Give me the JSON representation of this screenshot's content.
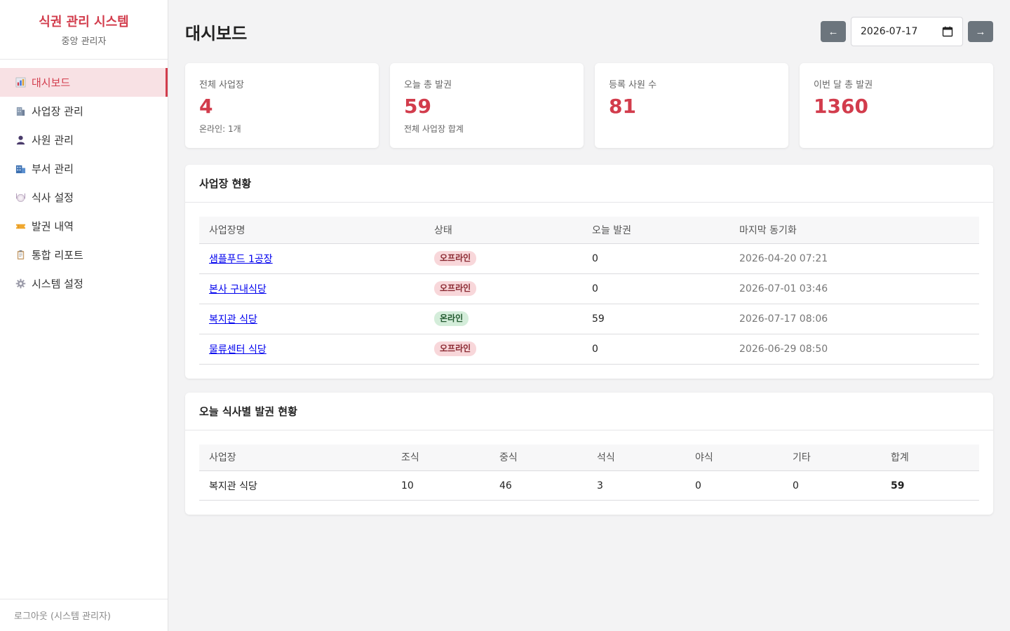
{
  "brand": {
    "title": "식권 관리 시스템",
    "subtitle": "중앙 관리자"
  },
  "sidebar": {
    "items": [
      {
        "label": "대시보드",
        "icon": "chart-icon",
        "active": true
      },
      {
        "label": "사업장 관리",
        "icon": "building-icon",
        "active": false
      },
      {
        "label": "사원 관리",
        "icon": "user-icon",
        "active": false
      },
      {
        "label": "부서 관리",
        "icon": "office-icon",
        "active": false
      },
      {
        "label": "식사 설정",
        "icon": "plate-icon",
        "active": false
      },
      {
        "label": "발권 내역",
        "icon": "ticket-icon",
        "active": false
      },
      {
        "label": "통합 리포트",
        "icon": "clipboard-icon",
        "active": false
      },
      {
        "label": "시스템 설정",
        "icon": "gear-icon",
        "active": false
      }
    ],
    "logout": "로그아웃 (시스템 관리자)"
  },
  "header": {
    "title": "대시보드",
    "prev": "←",
    "next": "→",
    "date": "2026-07-17"
  },
  "stats": [
    {
      "label": "전체 사업장",
      "value": "4",
      "sub": "온라인: 1개"
    },
    {
      "label": "오늘 총 발권",
      "value": "59",
      "sub": "전체 사업장 합계"
    },
    {
      "label": "등록 사원 수",
      "value": "81",
      "sub": ""
    },
    {
      "label": "이번 달 총 발권",
      "value": "1360",
      "sub": ""
    }
  ],
  "sites": {
    "title": "사업장 현황",
    "columns": [
      "사업장명",
      "상태",
      "오늘 발권",
      "마지막 동기화"
    ],
    "rows": [
      {
        "name": "샘플푸드 1공장",
        "status": "오프라인",
        "online": false,
        "today": "0",
        "sync": "2026-04-20 07:21"
      },
      {
        "name": "본사 구내식당",
        "status": "오프라인",
        "online": false,
        "today": "0",
        "sync": "2026-07-01 03:46"
      },
      {
        "name": "복지관 식당",
        "status": "온라인",
        "online": true,
        "today": "59",
        "sync": "2026-07-17 08:06"
      },
      {
        "name": "물류센터 식당",
        "status": "오프라인",
        "online": false,
        "today": "0",
        "sync": "2026-06-29 08:50"
      }
    ]
  },
  "meals": {
    "title": "오늘 식사별 발권 현황",
    "columns": [
      "사업장",
      "조식",
      "중식",
      "석식",
      "야식",
      "기타",
      "합계"
    ],
    "rows": [
      [
        "복지관 식당",
        "10",
        "46",
        "3",
        "0",
        "0",
        "59"
      ]
    ]
  },
  "colors": {
    "accent": "#d23c4c",
    "active_bg": "#f8e1e4",
    "button": "#6c757d"
  }
}
